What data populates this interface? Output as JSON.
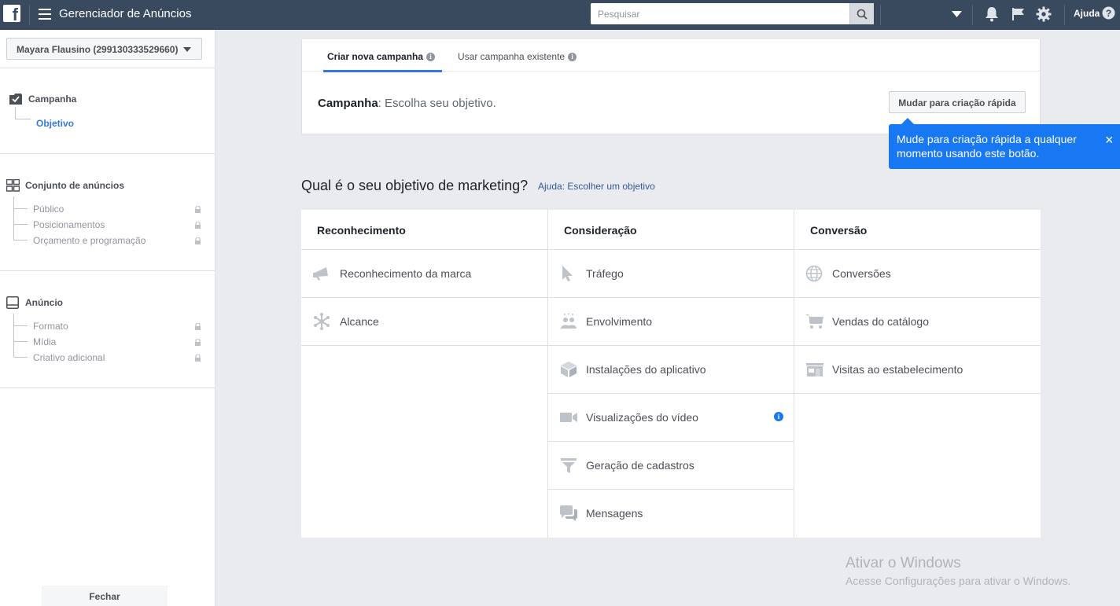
{
  "topbar": {
    "logo": "f",
    "app_title": "Gerenciador de Anúncios",
    "search_placeholder": "Pesquisar",
    "help_label": "Ajuda",
    "icons": [
      "menu-icon",
      "search-icon",
      "dropdown-icon",
      "bell-icon",
      "flag-icon",
      "gear-icon",
      "help-icon"
    ]
  },
  "sidebar": {
    "account": "Mayara Flausino (299130333529660)",
    "campaign": {
      "label": "Campanha",
      "sub": "Objetivo"
    },
    "adset": {
      "label": "Conjunto de anúncios",
      "items": [
        "Público",
        "Posicionamentos",
        "Orçamento e programação"
      ]
    },
    "ad": {
      "label": "Anúncio",
      "items": [
        "Formato",
        "Mídia",
        "Criativo adicional"
      ]
    },
    "close_label": "Fechar"
  },
  "card": {
    "tabs": [
      {
        "label": "Criar nova campanha",
        "active": true
      },
      {
        "label": "Usar campanha existente",
        "active": false
      }
    ],
    "campaign_label": "Campanha",
    "campaign_text": ": Escolha seu objetivo.",
    "quick_button": "Mudar para criação rápida"
  },
  "tooltip": {
    "text": "Mude para criação rápida a qualquer momento usando este botão.",
    "close": "×"
  },
  "objectives": {
    "question": "Qual é o seu objetivo de marketing?",
    "help_link": "Ajuda: Escolher um objetivo",
    "columns": [
      {
        "title": "Reconhecimento",
        "items": [
          {
            "label": "Reconhecimento da marca",
            "icon": "megaphone-icon"
          },
          {
            "label": "Alcance",
            "icon": "reach-icon"
          }
        ]
      },
      {
        "title": "Consideração",
        "items": [
          {
            "label": "Tráfego",
            "icon": "cursor-icon"
          },
          {
            "label": "Envolvimento",
            "icon": "people-icon"
          },
          {
            "label": "Instalações do aplicativo",
            "icon": "box-icon"
          },
          {
            "label": "Visualizações do vídeo",
            "icon": "video-icon"
          },
          {
            "label": "Geração de cadastros",
            "icon": "funnel-icon"
          },
          {
            "label": "Mensagens",
            "icon": "chat-icon"
          }
        ]
      },
      {
        "title": "Conversão",
        "items": [
          {
            "label": "Conversões",
            "icon": "globe-icon"
          },
          {
            "label": "Vendas do catálogo",
            "icon": "cart-icon"
          },
          {
            "label": "Visitas ao estabelecimento",
            "icon": "store-icon"
          }
        ]
      }
    ]
  },
  "watermark": {
    "title": "Ativar o Windows",
    "subtitle": "Acesse Configurações para ativar o Windows."
  },
  "colors": {
    "topbar": "#39495e",
    "accent": "#1877f2",
    "link": "#365899",
    "icon_gray": "#bec3c9"
  }
}
